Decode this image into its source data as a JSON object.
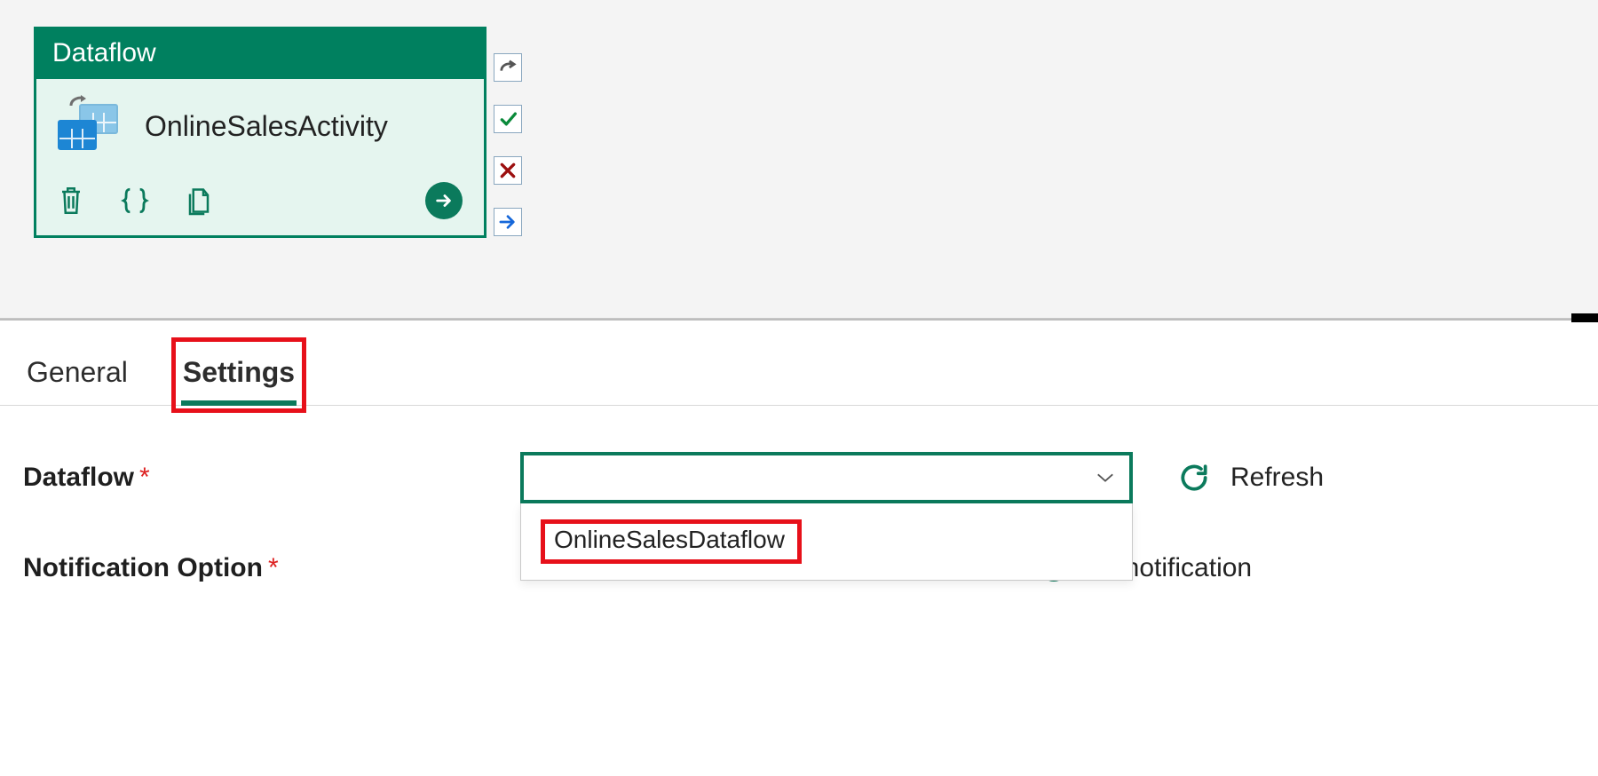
{
  "activity": {
    "type_label": "Dataflow",
    "name": "OnlineSalesActivity"
  },
  "tabs": {
    "general": "General",
    "settings": "Settings",
    "active": "settings",
    "highlighted": "settings"
  },
  "settings": {
    "dataflow_label": "Dataflow",
    "dataflow_value": "",
    "dataflow_options": [
      "OnlineSalesDataflow"
    ],
    "refresh_label": "Refresh",
    "notification_label": "Notification Option",
    "notification_selected": "No notification"
  },
  "icons": {
    "redo": "redo-icon",
    "success": "check-icon",
    "error": "x-icon",
    "skip": "arrow-right-icon",
    "delete": "trash-icon",
    "braces": "braces-icon",
    "copy": "copy-icon",
    "proceed": "circle-arrow-icon",
    "flow": "dataflow-icon",
    "chevron": "chevron-down-icon",
    "refresh": "refresh-icon"
  }
}
